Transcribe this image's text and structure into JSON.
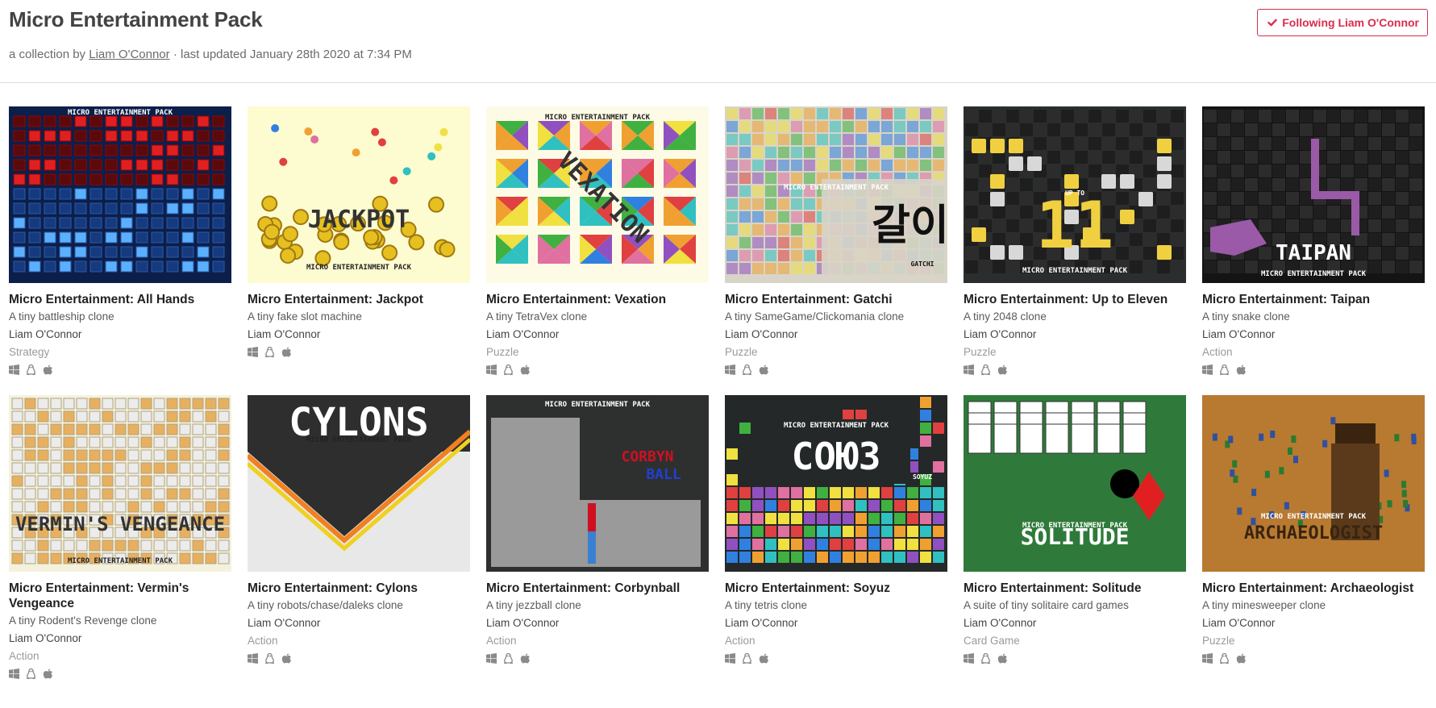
{
  "header": {
    "title": "Micro Entertainment Pack",
    "subtitle_prefix": "a collection by ",
    "author_link": "Liam O'Connor",
    "subtitle_suffix": " · last updated January 28th 2020 at 7:34 PM",
    "follow_button": "Following Liam O'Connor"
  },
  "games": [
    {
      "title": "Micro Entertainment: All Hands",
      "desc": "A tiny battleship clone",
      "author": "Liam O'Connor",
      "genre": "Strategy",
      "art": {
        "bg": "#0c1f4a",
        "accent": "#c01515",
        "text": "",
        "banner": "MICRO ENTERTAINMENT PACK"
      }
    },
    {
      "title": "Micro Entertainment: Jackpot",
      "desc": "A tiny fake slot machine",
      "author": "Liam O'Connor",
      "genre": "",
      "art": {
        "bg": "#fdfbd0",
        "accent": "#e5c020",
        "text": "JACKPOT",
        "banner": "MICRO ENTERTAINMENT PACK"
      }
    },
    {
      "title": "Micro Entertainment: Vexation",
      "desc": "A tiny TetraVex clone",
      "author": "Liam O'Connor",
      "genre": "Puzzle",
      "art": {
        "bg": "#fdfbe6",
        "accent": "#e8a020",
        "text": "VEXATION",
        "banner": "MICRO ENTERTAINMENT PACK"
      }
    },
    {
      "title": "Micro Entertainment: Gatchi",
      "desc": "A tiny SameGame/Clickomania clone",
      "author": "Liam O'Connor",
      "genre": "Puzzle",
      "art": {
        "bg": "#d8d4c8",
        "accent": "#e59aa0",
        "text": "갈이",
        "banner": "MICRO ENTERTAINMENT PACK",
        "caption": "GATCHI"
      }
    },
    {
      "title": "Micro Entertainment: Up to Eleven",
      "desc": "A tiny 2048 clone",
      "author": "Liam O'Connor",
      "genre": "Puzzle",
      "art": {
        "bg": "#2a2e2e",
        "accent": "#f0d040",
        "text": "11",
        "banner": "MICRO ENTERTAINMENT PACK",
        "caption": "UP TO"
      }
    },
    {
      "title": "Micro Entertainment: Taipan",
      "desc": "A tiny snake clone",
      "author": "Liam O'Connor",
      "genre": "Action",
      "art": {
        "bg": "#141414",
        "accent": "#9a5aa8",
        "text": "TAIPAN",
        "banner": "MICRO ENTERTAINMENT PACK"
      }
    },
    {
      "title": "Micro Entertainment: Vermin's Vengeance",
      "desc": "A tiny Rodent's Revenge clone",
      "author": "Liam O'Connor",
      "genre": "Action",
      "art": {
        "bg": "#f4f2dc",
        "accent": "#e7b060",
        "text": "VERMIN'S VENGEANCE",
        "banner": "MICRO ENTERTAINMENT PACK"
      }
    },
    {
      "title": "Micro Entertainment: Cylons",
      "desc": "A tiny robots/chase/daleks clone",
      "author": "Liam O'Connor",
      "genre": "Action",
      "art": {
        "bg": "#e8e8e8",
        "accent": "#f08020",
        "text": "CYLONS",
        "banner": "MICRO ENTERTAINMENT PACK"
      }
    },
    {
      "title": "Micro Entertainment: Corbynball",
      "desc": "A tiny jezzball clone",
      "author": "Liam O'Connor",
      "genre": "Action",
      "art": {
        "bg": "#2e3030",
        "accent": "#d01020",
        "text": "CORBYN",
        "text2": "BALL",
        "banner": "MICRO ENTERTAINMENT PACK"
      }
    },
    {
      "title": "Micro Entertainment: Soyuz",
      "desc": "A tiny tetris clone",
      "author": "Liam O'Connor",
      "genre": "Action",
      "art": {
        "bg": "#242828",
        "accent": "#e04020",
        "text": "СОЮЗ",
        "banner": "MICRO ENTERTAINMENT PACK",
        "caption": "SOYUZ"
      }
    },
    {
      "title": "Micro Entertainment: Solitude",
      "desc": "A suite of tiny solitaire card games",
      "author": "Liam O'Connor",
      "genre": "Card Game",
      "art": {
        "bg": "#2f7a3a",
        "accent": "#e02020",
        "text": "SOLITUDE",
        "banner": "MICRO ENTERTAINMENT PACK"
      }
    },
    {
      "title": "Micro Entertainment: Archaeologist",
      "desc": "A tiny minesweeper clone",
      "author": "Liam O'Connor",
      "genre": "Puzzle",
      "art": {
        "bg": "#b87a30",
        "accent": "#e8b050",
        "text": "ARCHAEOLOGIST",
        "banner": "MICRO ENTERTAINMENT PACK"
      }
    }
  ],
  "platform_icons": [
    "windows-icon",
    "linux-icon",
    "apple-icon"
  ],
  "colors": {
    "follow_accent": "#da2c4d"
  }
}
